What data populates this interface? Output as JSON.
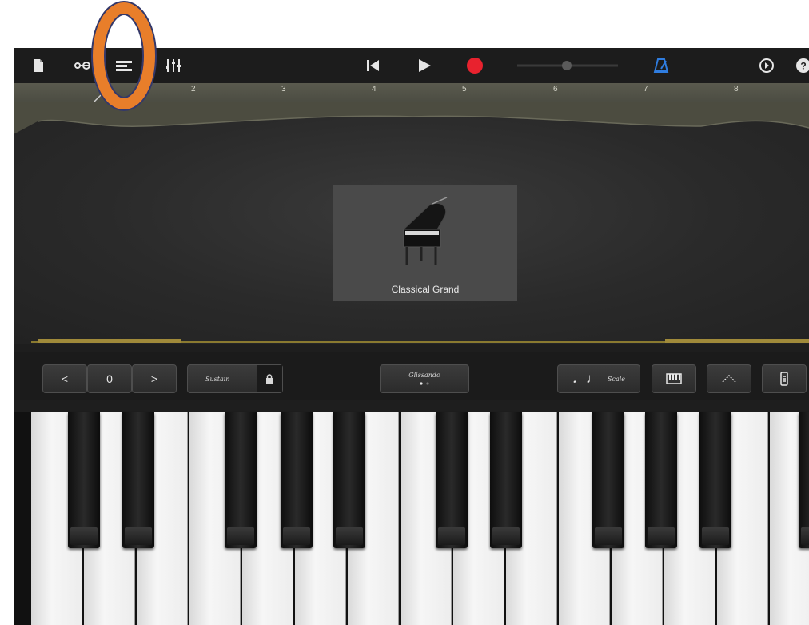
{
  "toolbar": {
    "icons": [
      "document-icon",
      "loop-icon",
      "tracks-view-icon",
      "mixer-icon",
      "rewind-icon",
      "play-icon",
      "record-icon",
      "volume-slider",
      "metronome-icon",
      "settings-icon",
      "help-icon"
    ],
    "record_color": "#e8222e",
    "metronome_color": "#2f7de0"
  },
  "ruler": {
    "bars": [
      "2",
      "3",
      "4",
      "5",
      "6",
      "7",
      "8"
    ]
  },
  "instrument": {
    "name": "Classical Grand"
  },
  "controls": {
    "octave_down": "<",
    "octave_value": "0",
    "octave_up": ">",
    "sustain_label": "Sustain",
    "glissando_label": "Glissando",
    "scale_label": "Scale",
    "notes_glyph": "♩♩"
  },
  "annotation": {
    "ring_color": "#e87e2a"
  },
  "colors": {
    "accent_gold": "#a08a3a"
  }
}
